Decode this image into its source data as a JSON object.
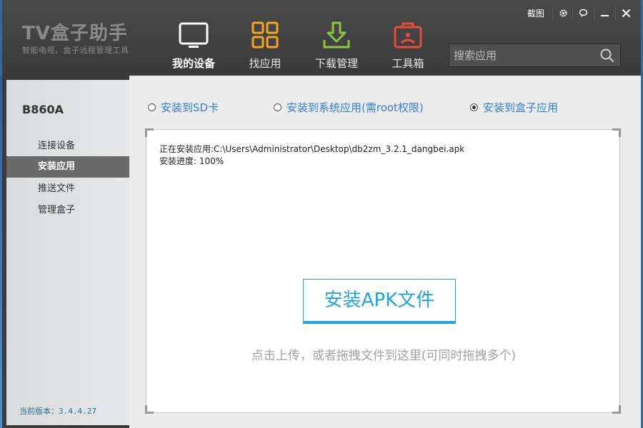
{
  "app": {
    "logo_title": "TV盒子助手",
    "logo_subtitle": "智能电视，盒子远程管理工具"
  },
  "window_controls": {
    "screenshot_label": "截图",
    "icons": [
      "gear-icon",
      "feedback-icon",
      "minimize-icon",
      "close-icon"
    ]
  },
  "nav": {
    "items": [
      {
        "label": "我的设备",
        "icon": "tv-icon",
        "active": true
      },
      {
        "label": "找应用",
        "icon": "grid-icon",
        "active": false
      },
      {
        "label": "下载管理",
        "icon": "download-icon",
        "active": false
      },
      {
        "label": "工具箱",
        "icon": "toolbox-icon",
        "active": false
      }
    ]
  },
  "search": {
    "placeholder": "搜索应用",
    "value": ""
  },
  "sidebar": {
    "device_name": "B860A",
    "items": [
      {
        "label": "连接设备",
        "active": false
      },
      {
        "label": "安装应用",
        "active": true
      },
      {
        "label": "推送文件",
        "active": false
      },
      {
        "label": "管理盒子",
        "active": false
      }
    ],
    "version": "当前版本：3.4.4.27"
  },
  "install_options": {
    "options": [
      {
        "label": "安装到SD卡",
        "checked": false
      },
      {
        "label": "安装到系统应用(需root权限)",
        "checked": false
      },
      {
        "label": "安装到盒子应用",
        "checked": true
      }
    ]
  },
  "panel": {
    "installing_line": "正在安装应用:C:\\Users\\Administrator\\Desktop\\db2zm_3.2.1_dangbei.apk",
    "progress_line": "安装进度:   100%",
    "progress_percent": 100,
    "install_button_label": "安装APK文件",
    "hint": "点击上传，或者拖拽文件到这里(可同时拖拽多个)"
  },
  "colors": {
    "accent_blue": "#22a2e0",
    "radio_blue": "#2f7fd3",
    "header_bg": "#3a3a3a",
    "tv_icon_white": "#ffffff",
    "grid_icon_orange": "#f5a623",
    "download_icon_green": "#8cc63f",
    "toolbox_icon_red": "#e74c3c"
  }
}
